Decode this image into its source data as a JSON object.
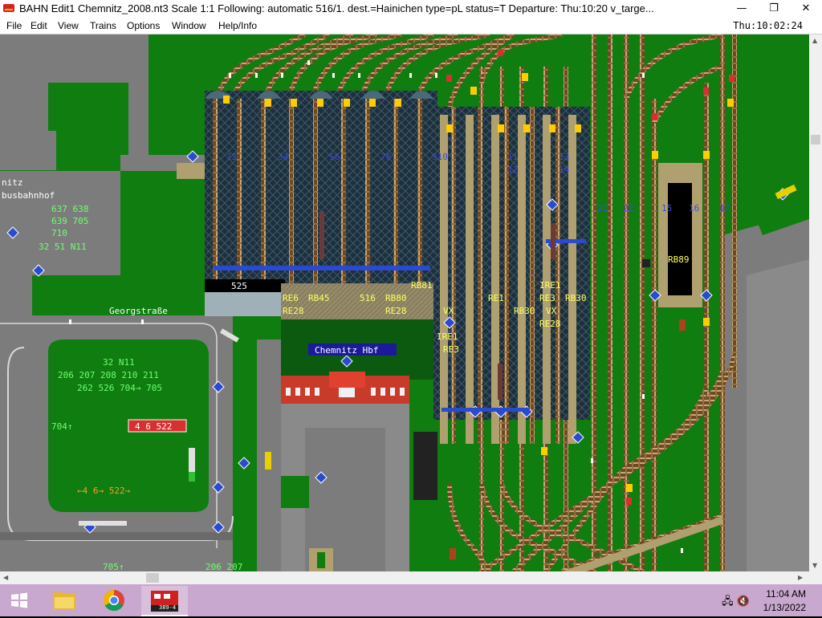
{
  "window": {
    "title": "BAHN Edit1 Chemnitz_2008.nt3 Scale 1:1 Following: automatic 516/1.  dest.=Hainichen type=pL status=T  Departure: Thu:10:20 v_targe...",
    "minimize_glyph": "—",
    "maximize_glyph": "❐",
    "close_glyph": "✕"
  },
  "menu": {
    "items": [
      "File",
      "Edit",
      "View",
      "Trains",
      "Options",
      "Window",
      "Help/Info"
    ],
    "clock": "Thu:10:02:24"
  },
  "colors": {
    "grass": "#0f7d10",
    "road": "#7c7c7c",
    "platform": "#b0a070",
    "track_brown": "#8a5a2a",
    "station_label_bg": "#1a1a9a",
    "signal_blue": "#2a4ad0",
    "route_text": "#ffff60",
    "bus_text": "#70ff70",
    "red_box": "#d83030"
  },
  "map": {
    "station_label": "Chemnitz Hbf",
    "street_label": "Georgstraße",
    "bus_station_lines": [
      "nitz",
      "busbahnhof"
    ],
    "bus_routes_top": [
      "637  638",
      "639  705",
      "710"
    ],
    "bus_lines_a": "32  51  N11",
    "bus_lines_b": "32  N11",
    "bus_routes_mid": [
      "206  207  208  210  211",
      "262  526  704→  705"
    ],
    "bus_704": "704↑",
    "bus_bottom_left": "←4  6→  522→",
    "red_box_text": "4  6  522",
    "bus_705": "705↑",
    "bus_206": "206  207",
    "board_525": "525",
    "track_numbers": [
      "12",
      "34",
      "56",
      "78",
      "910",
      "11",
      "13",
      "12",
      "14",
      "21",
      "22",
      "15",
      "16",
      "17"
    ],
    "route_labels": [
      {
        "id": "re6",
        "text": "RE6"
      },
      {
        "id": "rb45",
        "text": "RB45"
      },
      {
        "id": "re28a",
        "text": "RE28"
      },
      {
        "id": "516",
        "text": "516"
      },
      {
        "id": "rb80",
        "text": "RB80"
      },
      {
        "id": "re28b",
        "text": "RE28"
      },
      {
        "id": "rb81",
        "text": "RB81"
      },
      {
        "id": "vx1",
        "text": "VX"
      },
      {
        "id": "re1a",
        "text": "RE1"
      },
      {
        "id": "ire1a",
        "text": "IRE1"
      },
      {
        "id": "re3a",
        "text": "RE3"
      },
      {
        "id": "rb30a",
        "text": "RB30"
      },
      {
        "id": "ire1b",
        "text": "IRE1"
      },
      {
        "id": "re3b",
        "text": "RE3"
      },
      {
        "id": "rb30b",
        "text": "RB30"
      },
      {
        "id": "vx2",
        "text": "VX"
      },
      {
        "id": "re28c",
        "text": "RE28"
      },
      {
        "id": "rb89",
        "text": "RB89"
      }
    ]
  },
  "taskbar": {
    "time": "11:04 AM",
    "date": "1/13/2022",
    "app_badge": "389-4"
  }
}
